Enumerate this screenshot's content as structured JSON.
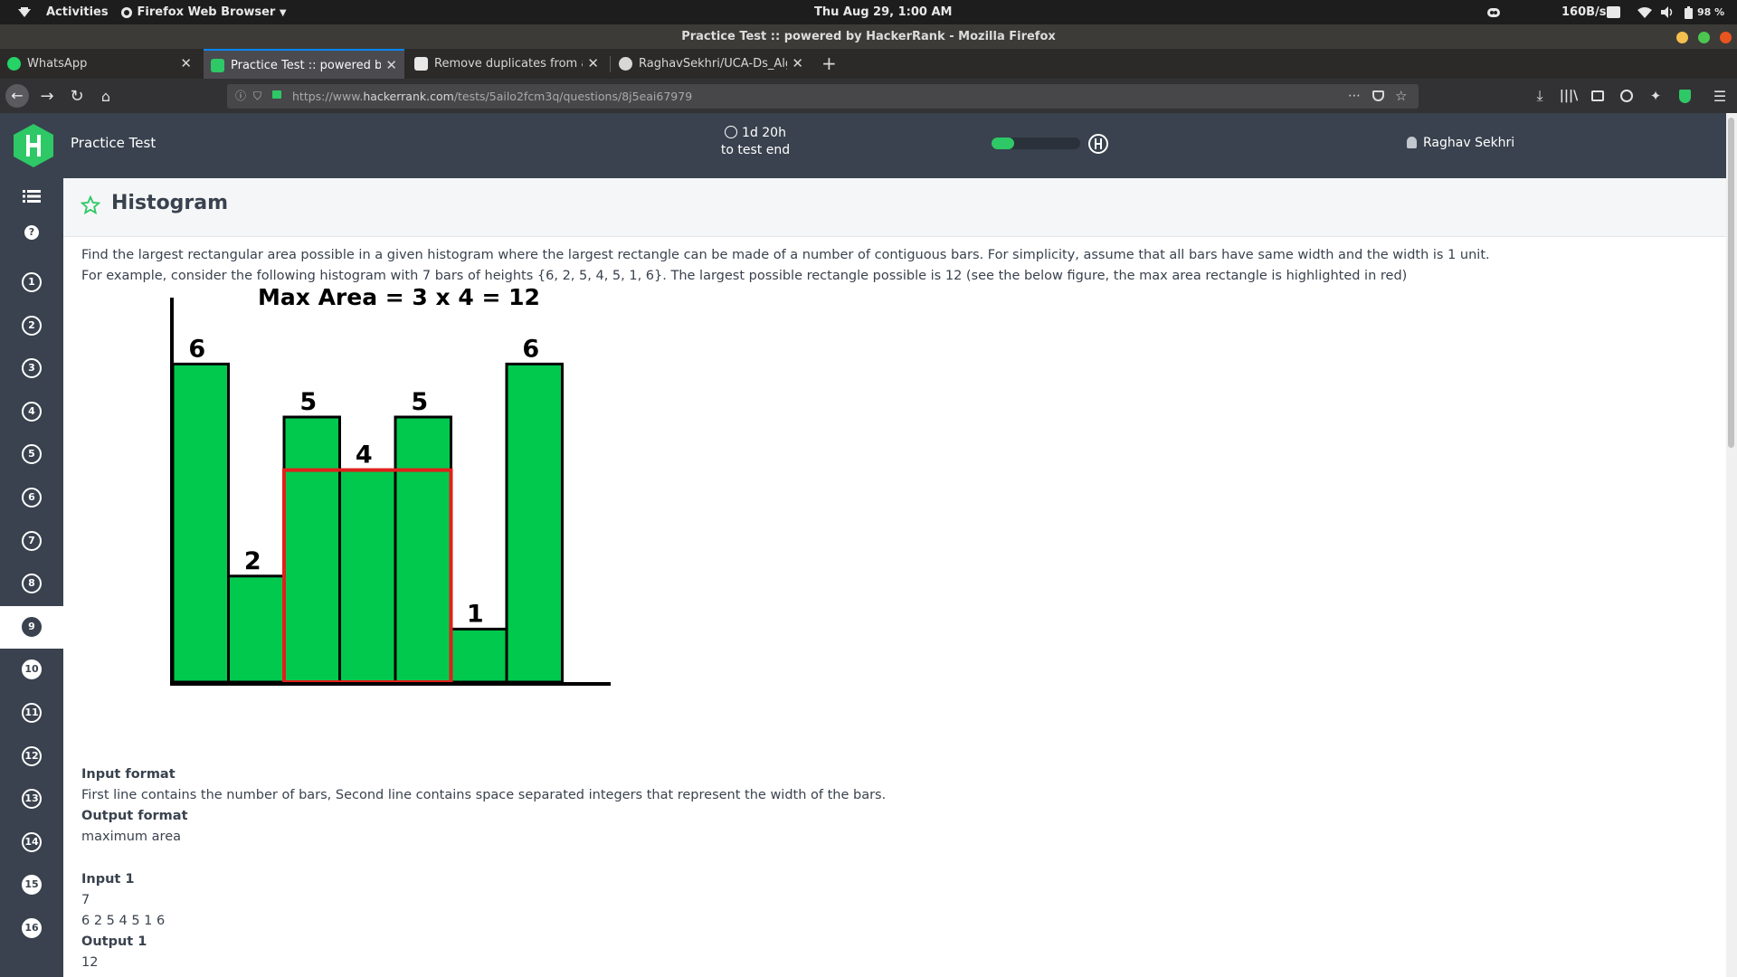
{
  "system_bar": {
    "activities": "Activities",
    "app_menu": "Firefox Web Browser",
    "clock": "Thu Aug 29,  1:00 AM",
    "net_speed": "160B/s",
    "battery": "98 %"
  },
  "window": {
    "title": "Practice Test :: powered by HackerRank - Mozilla Firefox"
  },
  "tabs": [
    {
      "label": "WhatsApp",
      "icon": "whatsapp-icon",
      "active": false
    },
    {
      "label": "Practice Test :: powered by HackerRank",
      "icon": "hackerrank-icon",
      "active": true
    },
    {
      "label": "Remove duplicates from an",
      "icon": "geeksforgeeks-icon",
      "active": false
    },
    {
      "label": "RaghavSekhri/UCA-Ds_Algo",
      "icon": "github-icon",
      "active": false
    }
  ],
  "url": {
    "prefix": "https://www.",
    "host": "hackerrank.com",
    "path": "/tests/5ailo2fcm3q/questions/8j5eai67979"
  },
  "hr_header": {
    "title": "Practice Test",
    "timer_value": "1d 20h",
    "timer_caption": "to test end",
    "progress": 0.25,
    "user_name": "Raghav Sekhri"
  },
  "question_nav": {
    "items": [
      {
        "label": "1",
        "state": "outline"
      },
      {
        "label": "2",
        "state": "outline"
      },
      {
        "label": "3",
        "state": "outline"
      },
      {
        "label": "4",
        "state": "outline"
      },
      {
        "label": "5",
        "state": "outline"
      },
      {
        "label": "6",
        "state": "outline"
      },
      {
        "label": "7",
        "state": "outline"
      },
      {
        "label": "8",
        "state": "outline"
      },
      {
        "label": "9",
        "state": "active"
      },
      {
        "label": "10",
        "state": "filled"
      },
      {
        "label": "11",
        "state": "outline"
      },
      {
        "label": "12",
        "state": "outline"
      },
      {
        "label": "13",
        "state": "outline"
      },
      {
        "label": "14",
        "state": "outline"
      },
      {
        "label": "15",
        "state": "filled"
      },
      {
        "label": "16",
        "state": "filled"
      }
    ]
  },
  "question": {
    "title": "Histogram",
    "para1": "Find the largest rectangular area possible in a given histogram where the largest rectangle can be made of a number of contiguous bars. For simplicity, assume that all bars have same width and the width is 1 unit.",
    "para2": "For example, consider the following histogram with 7 bars of heights {6, 2, 5, 4, 5, 1, 6}. The largest possible rectangle possible is 12 (see the below figure, the max area rectangle is highlighted in red)",
    "input_format_heading": "Input format",
    "input_format_text": "First line contains the number of bars, Second line contains space separated integers that represent the width of the bars.",
    "output_format_heading": "Output format",
    "output_format_text": "maximum area",
    "input1_heading": "Input 1",
    "input1_line1": "7",
    "input1_line2": "6 2 5 4 5 1 6",
    "output1_heading": "Output 1",
    "output1_value": "12"
  },
  "figure": {
    "caption": "Max Area = 3 x 4  = 12",
    "bars": [
      6,
      2,
      5,
      4,
      5,
      1,
      6
    ],
    "highlight": {
      "start": 2,
      "end": 4,
      "height": 4
    },
    "bar_color": "#00c94e",
    "highlight_color": "#e0201b"
  }
}
